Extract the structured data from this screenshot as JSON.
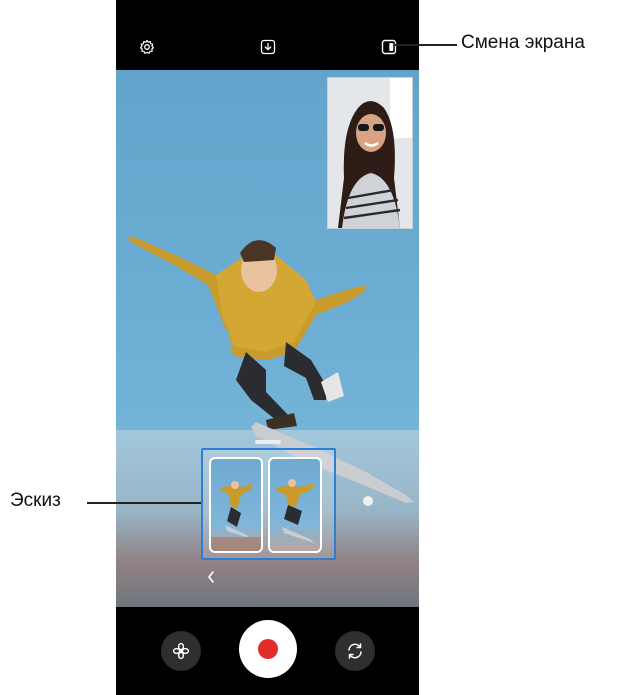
{
  "callouts": {
    "screen_switch": "Смена экрана",
    "thumbnail": "Эскиз"
  },
  "icons": {
    "settings": "gear-icon",
    "download": "download-icon",
    "screen_switch": "screen-switch-icon",
    "back": "chevron-left-icon",
    "filter": "flower-filter-icon",
    "record": "record-icon",
    "switch_camera": "switch-camera-icon"
  },
  "colors": {
    "record_dot": "#e22c2c",
    "thumbnail_highlight": "#2b7fd6",
    "background": "#000000"
  },
  "viewfinder": {
    "main_scene": "Skateboarder jumping against blue sky",
    "pip_scene": "Smiling woman with sunglasses"
  }
}
